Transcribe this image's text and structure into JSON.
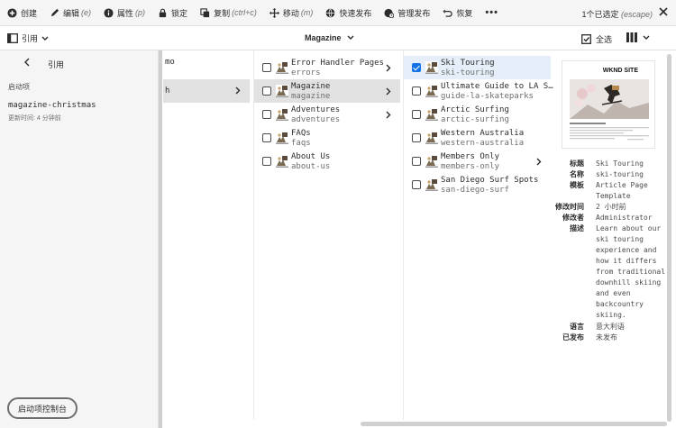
{
  "actionbar": {
    "create": "创建",
    "edit": "编辑",
    "edit_sc": "(e)",
    "properties": "属性",
    "properties_sc": "(p)",
    "lock": "锁定",
    "copy": "复制",
    "copy_sc": "(ctrl+c)",
    "move": "移动",
    "move_sc": "(m)",
    "quick_publish": "快速发布",
    "manage_publish": "管理发布",
    "restore": "恢复",
    "more": "•••",
    "selection": "1个已选定",
    "selection_sc": "(escape)"
  },
  "header": {
    "rail_label": "引用",
    "title": "Magazine",
    "select_all": "全选"
  },
  "rail": {
    "title": "引用",
    "section": "启动项",
    "item_name": "magazine-christmas",
    "item_time": "更新时间: 4 分钟前",
    "console_button": "启动项控制台"
  },
  "columns": {
    "col0": [
      "mo",
      "h"
    ],
    "col1": [
      {
        "title": "Error Handler Pages",
        "name": "errors",
        "arrow": true
      },
      {
        "title": "Magazine",
        "name": "magazine",
        "arrow": true
      },
      {
        "title": "Adventures",
        "name": "adventures",
        "arrow": true
      },
      {
        "title": "FAQs",
        "name": "faqs",
        "arrow": false
      },
      {
        "title": "About Us",
        "name": "about-us",
        "arrow": false
      }
    ],
    "col2": [
      {
        "title": "Ski Touring",
        "name": "ski-touring",
        "arrow": false
      },
      {
        "title": "Ultimate Guide to LA S…",
        "name": "guide-la-skateparks",
        "arrow": false
      },
      {
        "title": "Arctic Surfing",
        "name": "arctic-surfing",
        "arrow": false
      },
      {
        "title": "Western Australia",
        "name": "western-australia",
        "arrow": false
      },
      {
        "title": "Members Only",
        "name": "members-only",
        "arrow": true
      },
      {
        "title": "San Diego Surf Spots",
        "name": "san-diego-surf",
        "arrow": false
      }
    ]
  },
  "preview": {
    "brand": "WKND SITE",
    "keys": {
      "title": "标题",
      "name": "名称",
      "template": "模板",
      "modified": "修改时间",
      "modifier": "修改者",
      "description": "描述",
      "language": "语言",
      "published": "已发布"
    },
    "values": {
      "title": "Ski Touring",
      "name": "ski-touring",
      "template_1": "Article Page",
      "template_2": "Template",
      "modified": "2 小时前",
      "modifier": "Administrator",
      "desc_1": "Learn about our",
      "desc_2": "ski touring",
      "desc_3": "experience and",
      "desc_4": "how it differs",
      "desc_5": "from traditional",
      "desc_6": "downhill skiing",
      "desc_7": "and even",
      "desc_8": "backcountry",
      "desc_9": "skiing.",
      "language": "意大利语",
      "published": "未发布"
    }
  }
}
